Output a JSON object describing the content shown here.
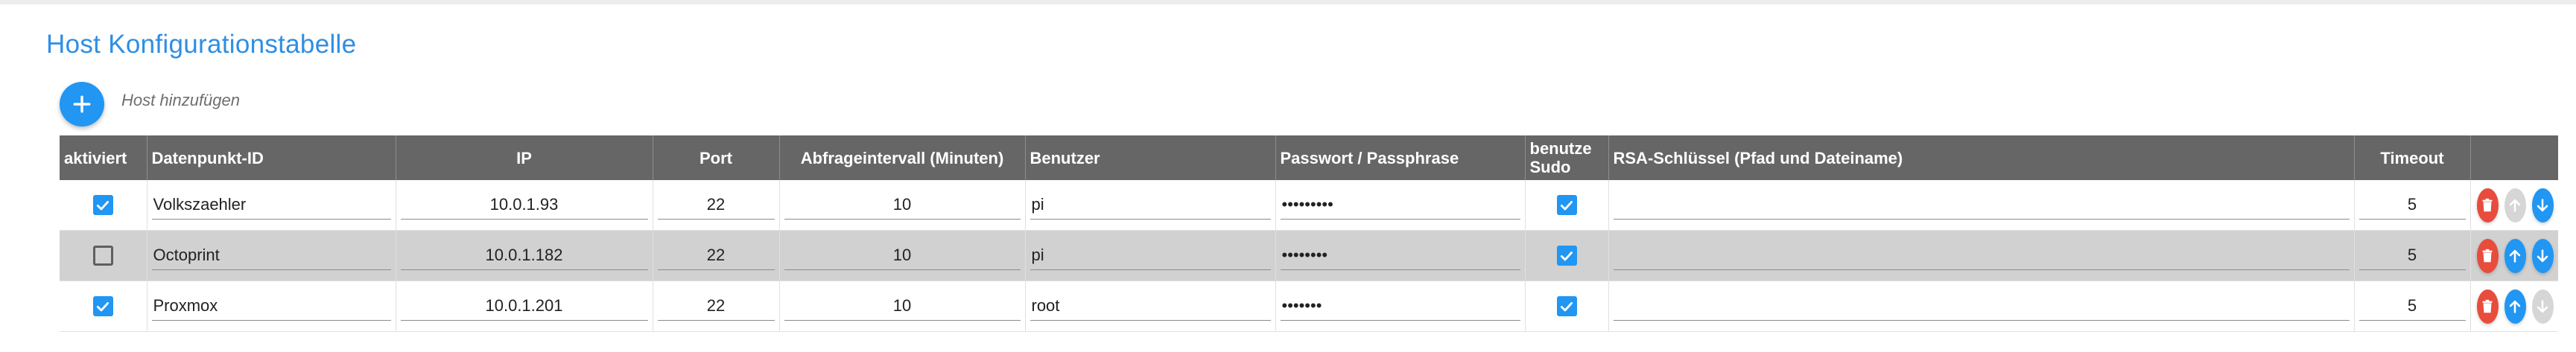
{
  "page": {
    "title": "Host Konfigurationstabelle"
  },
  "toolbar": {
    "add_label": "Host hinzufügen"
  },
  "columns": {
    "enabled": "aktiviert",
    "datapoint": "Datenpunkt-ID",
    "ip": "IP",
    "port": "Port",
    "interval": "Abfrageintervall (Minuten)",
    "user": "Benutzer",
    "password": "Passwort / Passphrase",
    "sudo": "benutze Sudo",
    "rsa": "RSA-Schlüssel (Pfad und Dateiname)",
    "timeout": "Timeout"
  },
  "rows": [
    {
      "enabled": true,
      "datapoint": "Volkszaehler",
      "ip": "10.0.1.93",
      "port": "22",
      "interval": "10",
      "user": "pi",
      "password": "•••••••••",
      "sudo": true,
      "rsa": "",
      "timeout": "5",
      "can_move_up": false,
      "can_move_down": true
    },
    {
      "enabled": false,
      "datapoint": "Octoprint",
      "ip": "10.0.1.182",
      "port": "22",
      "interval": "10",
      "user": "pi",
      "password": "••••••••",
      "sudo": true,
      "rsa": "",
      "timeout": "5",
      "can_move_up": true,
      "can_move_down": true
    },
    {
      "enabled": true,
      "datapoint": "Proxmox",
      "ip": "10.0.1.201",
      "port": "22",
      "interval": "10",
      "user": "root",
      "password": "•••••••",
      "sudo": true,
      "rsa": "",
      "timeout": "5",
      "can_move_up": true,
      "can_move_down": false
    }
  ],
  "icons": {
    "add": "plus-icon",
    "delete": "trash-icon",
    "up": "arrow-up-icon",
    "down": "arrow-down-icon",
    "check": "check-icon"
  },
  "colors": {
    "accent": "#2196f3",
    "title": "#2f8ee3",
    "header_bg": "#666666",
    "delete": "#e74c3c",
    "disabled": "#d6d6d6",
    "row_shaded": "#d1d1d1"
  }
}
